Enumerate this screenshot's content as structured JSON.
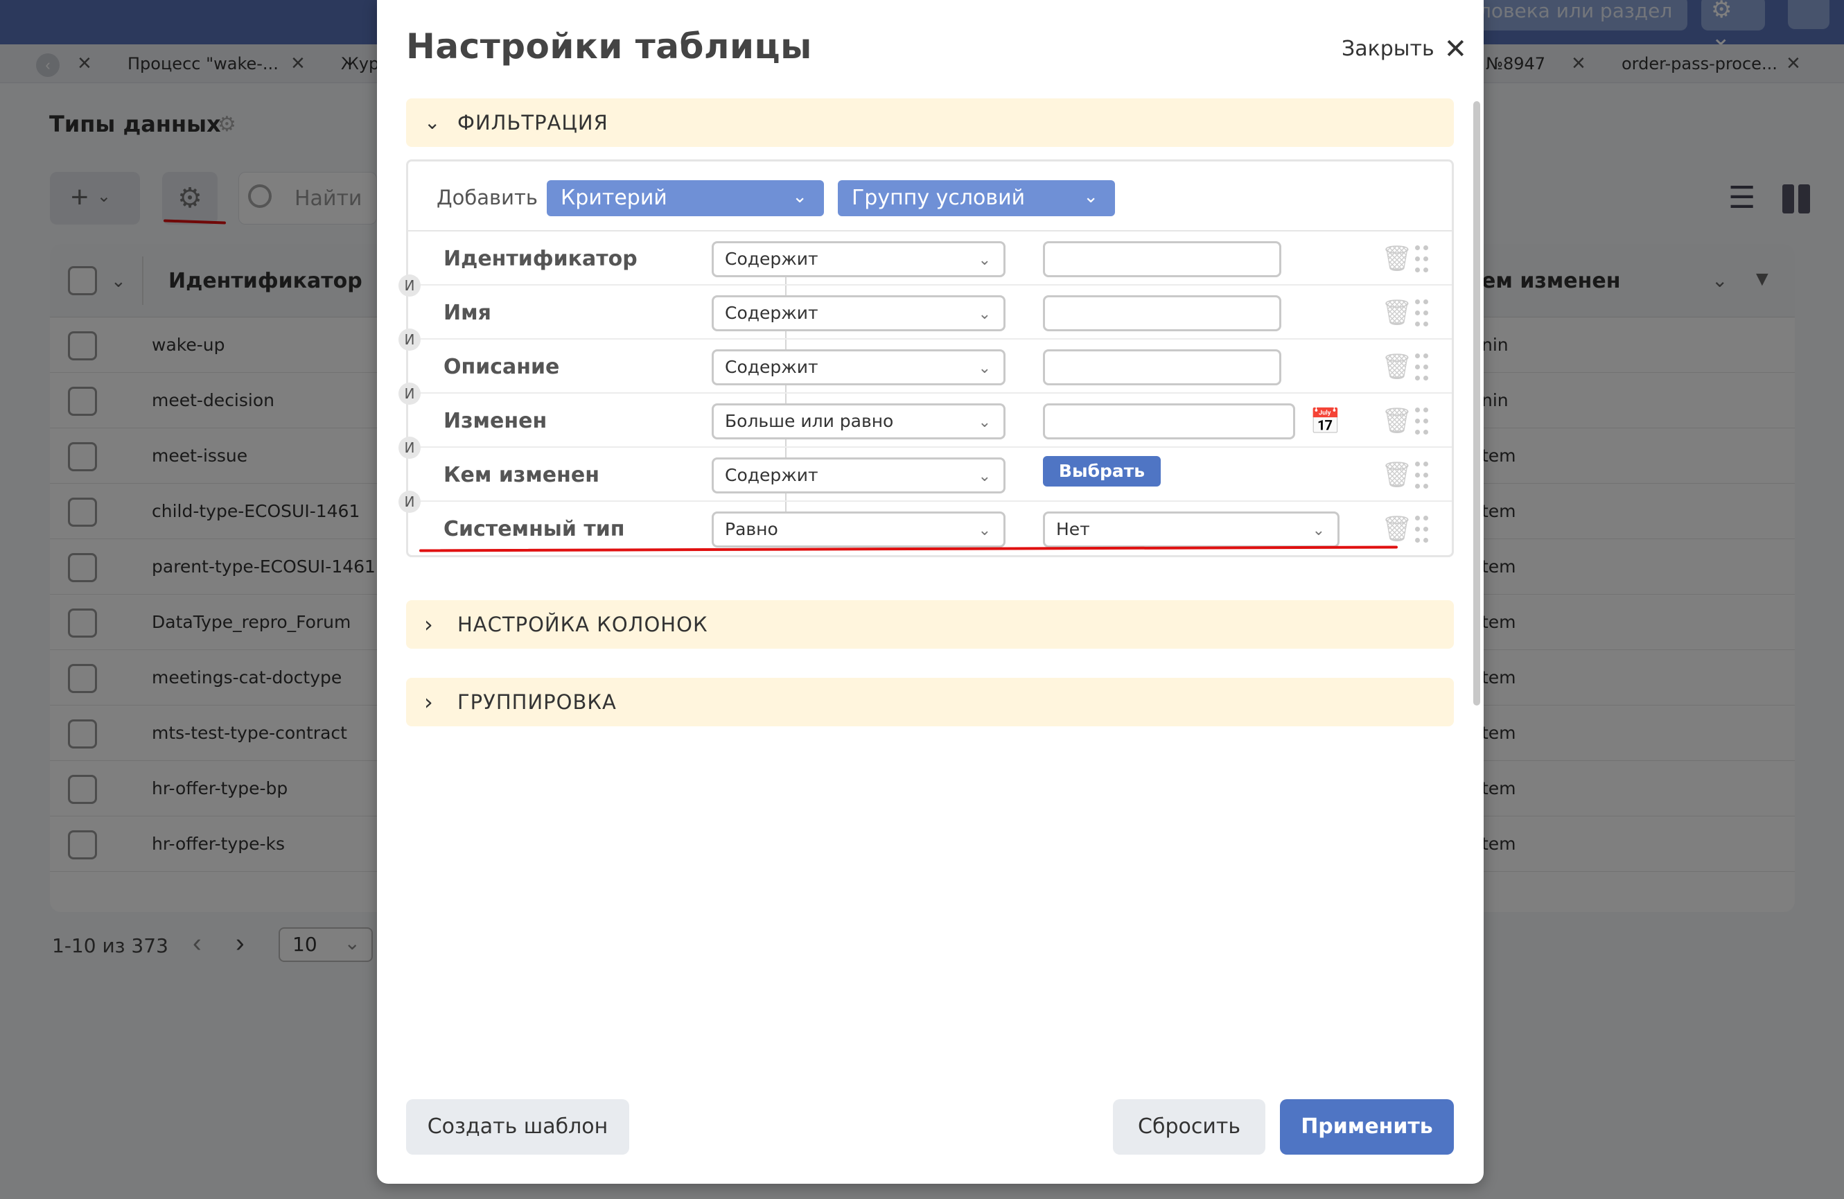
{
  "background": {
    "top_search": "ловека или раздел",
    "tabs": [
      {
        "label": "Процесс \"wake-..."
      },
      {
        "label": "Жур"
      },
      {
        "label": "№8947"
      },
      {
        "label": "order-pass-proce..."
      }
    ],
    "page_title": "Типы данных",
    "search_placeholder": "Найти",
    "table": {
      "col_id": "Идентификатор",
      "col_modified_by": "ем изменен",
      "rows": [
        {
          "id": "wake-up",
          "modified_by": "nin"
        },
        {
          "id": "meet-decision",
          "modified_by": "nin"
        },
        {
          "id": "meet-issue",
          "modified_by": "tem"
        },
        {
          "id": "child-type-ECOSUI-1461",
          "modified_by": "tem"
        },
        {
          "id": "parent-type-ECOSUI-1461",
          "modified_by": "tem"
        },
        {
          "id": "DataType_repro_Forum",
          "modified_by": "tem"
        },
        {
          "id": "meetings-cat-doctype",
          "modified_by": "tem"
        },
        {
          "id": "mts-test-type-contract",
          "modified_by": "tem"
        },
        {
          "id": "hr-offer-type-bp",
          "modified_by": "tem"
        },
        {
          "id": "hr-offer-type-ks",
          "modified_by": "tem"
        }
      ]
    },
    "pager": {
      "range": "1-10 из 373",
      "page_size": "10"
    }
  },
  "modal": {
    "title": "Настройки таблицы",
    "close_label": "Закрыть",
    "sections": {
      "filtering": "ФИЛЬТРАЦИЯ",
      "columns": "НАСТРОЙКА КОЛОНОК",
      "grouping": "ГРУППИРОВКА"
    },
    "add_label": "Добавить",
    "add_criterion": "Критерий",
    "add_group": "Группу условий",
    "and_label": "И",
    "criteria": [
      {
        "field": "Идентификатор",
        "operator": "Содержит",
        "value_type": "text"
      },
      {
        "field": "Имя",
        "operator": "Содержит",
        "value_type": "text"
      },
      {
        "field": "Описание",
        "operator": "Содержит",
        "value_type": "text"
      },
      {
        "field": "Изменен",
        "operator": "Больше или равно",
        "value_type": "date"
      },
      {
        "field": "Кем изменен",
        "operator": "Содержит",
        "value_type": "button",
        "value": "Выбрать"
      },
      {
        "field": "Системный тип",
        "operator": "Равно",
        "value_type": "select",
        "value": "Нет"
      }
    ],
    "footer": {
      "create_template": "Создать шаблон",
      "reset": "Сбросить",
      "apply": "Применить"
    }
  },
  "colors": {
    "topbar": "#5873b8",
    "accent_blue": "#4f75c4",
    "dropdown_blue": "#6f90d6",
    "section_bg": "#fff5dd",
    "highlight_red": "#e01010"
  }
}
